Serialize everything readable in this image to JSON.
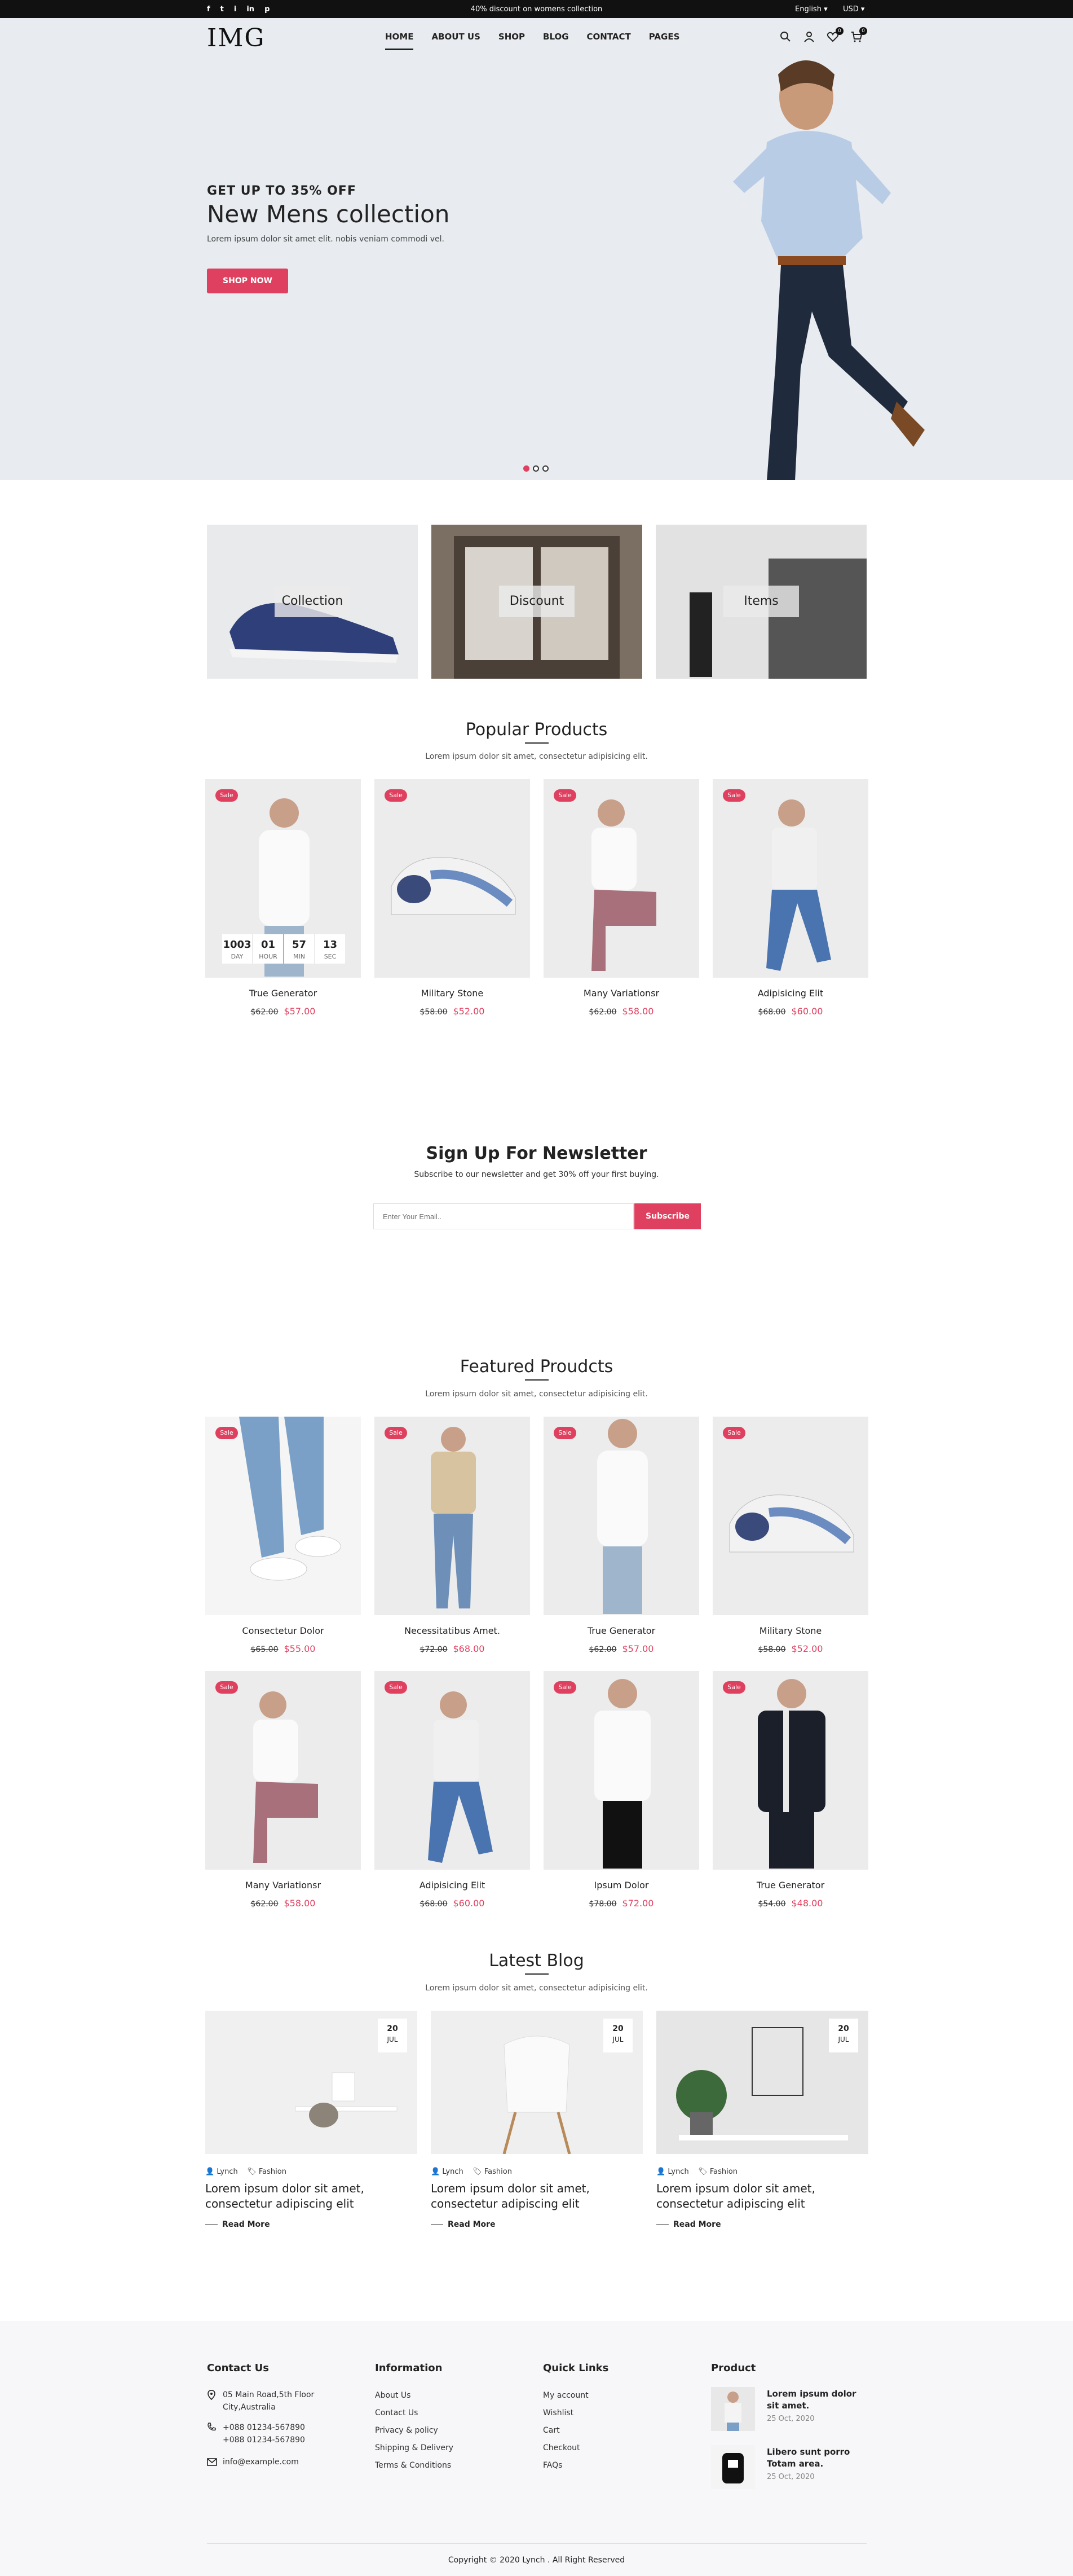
{
  "topbar": {
    "promo": "40% discount on womens collection",
    "language": "English",
    "currency": "USD",
    "social": [
      "f",
      "t",
      "i",
      "in",
      "p"
    ]
  },
  "header": {
    "logo": "IMG",
    "nav": [
      "HOME",
      "ABOUT US",
      "SHOP",
      "BLOG",
      "CONTACT",
      "PAGES"
    ],
    "wishlist_count": "0",
    "cart_count": "0"
  },
  "hero": {
    "kicker": "GET UP TO 35% OFF",
    "title": "New Mens collection",
    "subtitle": "Lorem ipsum dolor sit amet elit. nobis veniam commodi vel.",
    "button": "SHOP NOW"
  },
  "categories": [
    "Collection",
    "Discount",
    "Items"
  ],
  "popular": {
    "title": "Popular Products",
    "subtitle": "Lorem ipsum dolor sit amet, consectetur adipisicing elit.",
    "countdown": [
      {
        "value": "1003",
        "label": "DAY"
      },
      {
        "value": "01",
        "label": "HOUR"
      },
      {
        "value": "57",
        "label": "MIN"
      },
      {
        "value": "13",
        "label": "SEC"
      }
    ],
    "products": [
      {
        "name": "True Generator",
        "old": "$62.00",
        "price": "$57.00",
        "sale": "Sale"
      },
      {
        "name": "Military Stone",
        "old": "$58.00",
        "price": "$52.00",
        "sale": "Sale"
      },
      {
        "name": "Many Variationsr",
        "old": "$62.00",
        "price": "$58.00",
        "sale": "Sale"
      },
      {
        "name": "Adipisicing Elit",
        "old": "$68.00",
        "price": "$60.00",
        "sale": "Sale"
      }
    ]
  },
  "newsletter": {
    "title": "Sign Up For Newsletter",
    "subtitle": "Subscribe to our newsletter and get 30% off your first buying.",
    "placeholder": "Enter Your Email..",
    "button": "Subscribe"
  },
  "featured": {
    "title": "Featured Proudcts",
    "subtitle": "Lorem ipsum dolor sit amet, consectetur adipisicing elit.",
    "products": [
      {
        "name": "Consectetur Dolor",
        "old": "$65.00",
        "price": "$55.00",
        "sale": "Sale"
      },
      {
        "name": "Necessitatibus Amet.",
        "old": "$72.00",
        "price": "$68.00",
        "sale": "Sale"
      },
      {
        "name": "True Generator",
        "old": "$62.00",
        "price": "$57.00",
        "sale": "Sale"
      },
      {
        "name": "Military Stone",
        "old": "$58.00",
        "price": "$52.00",
        "sale": "Sale"
      },
      {
        "name": "Many Variationsr",
        "old": "$62.00",
        "price": "$58.00",
        "sale": "Sale"
      },
      {
        "name": "Adipisicing Elit",
        "old": "$68.00",
        "price": "$60.00",
        "sale": "Sale"
      },
      {
        "name": "Ipsum Dolor",
        "old": "$78.00",
        "price": "$72.00",
        "sale": "Sale"
      },
      {
        "name": "True Generator",
        "old": "$54.00",
        "price": "$48.00",
        "sale": "Sale"
      }
    ]
  },
  "blog": {
    "title": "Latest Blog",
    "subtitle": "Lorem ipsum dolor sit amet, consectetur adipisicing elit.",
    "posts": [
      {
        "day": "20",
        "month": "JUL",
        "author": "Lynch",
        "category": "Fashion",
        "title": "Lorem ipsum dolor sit amet, consectetur adipiscing elit",
        "more": "Read More"
      },
      {
        "day": "20",
        "month": "JUL",
        "author": "Lynch",
        "category": "Fashion",
        "title": "Lorem ipsum dolor sit amet, consectetur adipiscing elit",
        "more": "Read More"
      },
      {
        "day": "20",
        "month": "JUL",
        "author": "Lynch",
        "category": "Fashion",
        "title": "Lorem ipsum dolor sit amet, consectetur adipiscing elit",
        "more": "Read More"
      }
    ]
  },
  "footer": {
    "contact": {
      "title": "Contact Us",
      "address1": "05 Main Road,5th Floor",
      "address2": "City,Australia",
      "phone1": "+088 01234-567890",
      "phone2": "+088 01234-567890",
      "email": "info@example.com"
    },
    "information": {
      "title": "Information",
      "links": [
        "About Us",
        "Contact Us",
        "Privacy & policy",
        "Shipping & Delivery",
        "Terms & Conditions"
      ]
    },
    "quick": {
      "title": "Quick Links",
      "links": [
        "My account",
        "Wishlist",
        "Cart",
        "Checkout",
        "FAQs"
      ]
    },
    "product": {
      "title": "Product",
      "items": [
        {
          "title": "Lorem ipsum dolor sit amet.",
          "date": "25 Oct, 2020"
        },
        {
          "title": "Libero sunt porro Totam area.",
          "date": "25 Oct, 2020"
        }
      ]
    },
    "copyright": "Copyright © 2020 Lynch . All Right Reserved"
  },
  "colors": {
    "accent": "#e0405f",
    "topbar": "#111111",
    "hero_bg": "#e8ebef"
  }
}
